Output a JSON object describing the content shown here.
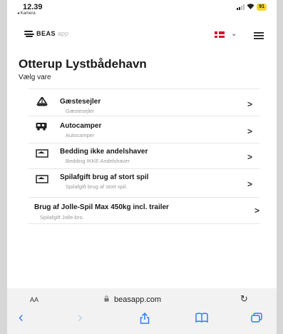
{
  "status_bar": {
    "time": "12.39",
    "back_app": "◂ Kamera",
    "battery": "91"
  },
  "header": {
    "logo_text": "BEAS",
    "logo_sub": "app",
    "language_chevron": "⌄"
  },
  "page": {
    "title": "Otterup Lystbådehavn",
    "subtitle": "Vælg vare"
  },
  "items": [
    {
      "name": "Gæstesejler",
      "desc": "Gæstesejler",
      "icon": "sailboat-icon",
      "chevron": ">"
    },
    {
      "name": "Autocamper",
      "desc": "Autocamper",
      "icon": "camper-icon",
      "chevron": ">"
    },
    {
      "name": "Bedding ikke andelshaver",
      "desc": "Bedding IKKE Andelshaver",
      "icon": "boat-storage-icon",
      "chevron": ">"
    },
    {
      "name": "Spilafgift brug af stort spil",
      "desc": "Spilafgift brug af stort spil.",
      "icon": "crane-icon",
      "chevron": ">"
    },
    {
      "name": "Brug af Jolle-Spil Max 450kg incl. trailer",
      "desc": "Spilafgift Jolle-bro.",
      "icon": "",
      "chevron": ">"
    }
  ],
  "browser": {
    "aa": "AA",
    "url": "beasapp.com",
    "reload": "↻"
  },
  "toolbar": {
    "back": "‹",
    "forward": "›",
    "share": "⇪",
    "bookmarks": "▭",
    "tabs": "⧉"
  }
}
